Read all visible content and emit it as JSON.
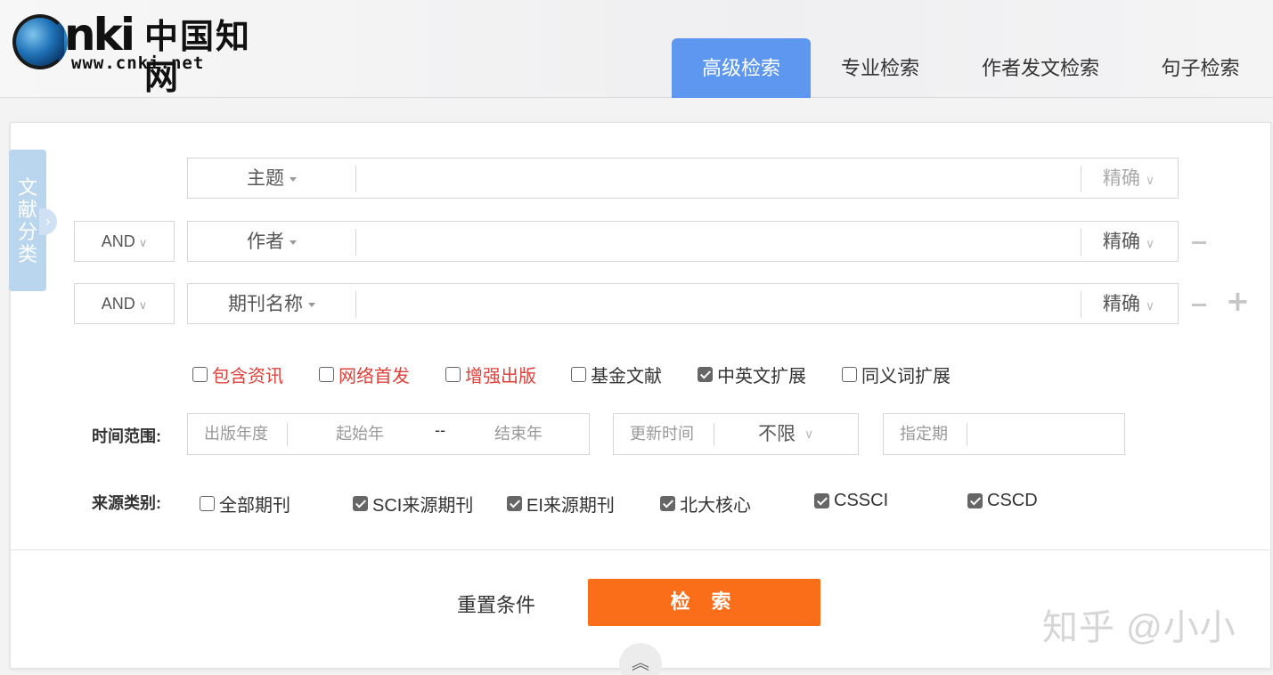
{
  "logo": {
    "mark": "CNKI",
    "chinese": "中国知网",
    "url": "www.cnki.net"
  },
  "tabs": [
    {
      "label": "高级检索",
      "active": true
    },
    {
      "label": "专业检索",
      "active": false
    },
    {
      "label": "作者发文检索",
      "active": false
    },
    {
      "label": "句子检索",
      "active": false
    }
  ],
  "side_tab": {
    "label_chars": [
      "文",
      "献",
      "分",
      "类"
    ]
  },
  "query_rows": [
    {
      "logic": "",
      "field": "主题",
      "match": "精确"
    },
    {
      "logic": "AND",
      "field": "作者",
      "match": "精确"
    },
    {
      "logic": "AND",
      "field": "期刊名称",
      "match": "精确"
    }
  ],
  "options": [
    {
      "label": "包含资讯",
      "checked": false,
      "color": "#e0413b"
    },
    {
      "label": "网络首发",
      "checked": false,
      "color": "#e0413b"
    },
    {
      "label": "增强出版",
      "checked": false,
      "color": "#e0413b"
    },
    {
      "label": "基金文献",
      "checked": false,
      "color": "#333333"
    },
    {
      "label": "中英文扩展",
      "checked": true,
      "color": "#333333"
    },
    {
      "label": "同义词扩展",
      "checked": false,
      "color": "#333333"
    }
  ],
  "time_range": {
    "label": "时间范围:",
    "pub_year_label": "出版年度",
    "start_placeholder": "起始年",
    "dash": "--",
    "end_placeholder": "结束年",
    "update_label": "更新时间",
    "update_value": "不限",
    "period_label": "指定期"
  },
  "source": {
    "label": "来源类别:",
    "items": [
      {
        "label": "全部期刊",
        "checked": false
      },
      {
        "label": "SCI来源期刊",
        "checked": true
      },
      {
        "label": "EI来源期刊",
        "checked": true
      },
      {
        "label": "北大核心",
        "checked": true
      },
      {
        "label": "CSSCI",
        "checked": true
      },
      {
        "label": "CSCD",
        "checked": true
      }
    ]
  },
  "actions": {
    "reset": "重置条件",
    "search": "检 索"
  },
  "watermark": "知乎 @小小",
  "colors": {
    "accent": "#5d97f0",
    "search_button": "#fa6e1a",
    "red_option": "#e0413b",
    "side_tab": "#b9d6ee"
  }
}
